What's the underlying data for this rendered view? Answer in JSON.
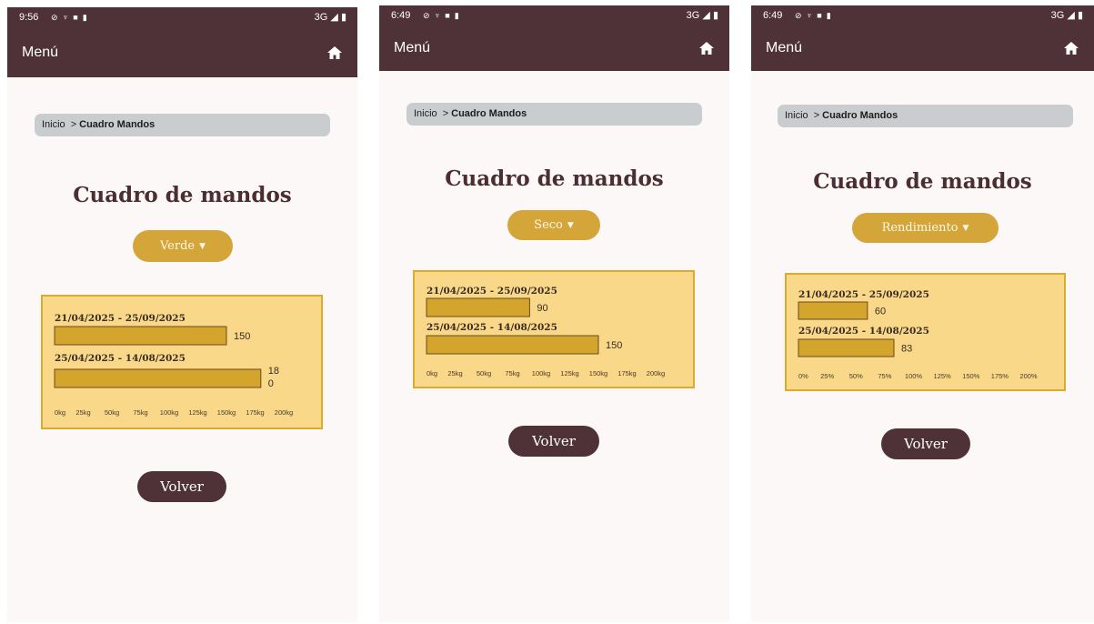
{
  "colors": {
    "appbar": "#4f3237",
    "accent": "#d4a63a",
    "chart_bg": "#f9d889",
    "bar": "#d4a52c",
    "title": "#4a2e33"
  },
  "screens": [
    {
      "status": {
        "time": "9:56",
        "icons": [
          "do-not-disturb-icon",
          "usb-icon",
          "notification-icon",
          "sd-card-icon"
        ],
        "network": "3G"
      },
      "appbar": {
        "menu": "Menú",
        "home_icon": "home-icon"
      },
      "breadcrumb": {
        "home": "Inicio",
        "separator": ">",
        "current": "Cuadro Mandos"
      },
      "title": "Cuadro de mandos",
      "dropdown": {
        "selected": "Verde"
      },
      "back": "Volver"
    },
    {
      "status": {
        "time": "6:49",
        "icons": [
          "do-not-disturb-icon",
          "usb-icon",
          "notification-icon",
          "sd-card-icon"
        ],
        "network": "3G"
      },
      "appbar": {
        "menu": "Menú",
        "home_icon": "home-icon"
      },
      "breadcrumb": {
        "home": "Inicio",
        "separator": ">",
        "current": "Cuadro Mandos"
      },
      "title": "Cuadro de mandos",
      "dropdown": {
        "selected": "Seco"
      },
      "back": "Volver"
    },
    {
      "status": {
        "time": "6:49",
        "icons": [
          "do-not-disturb-icon",
          "usb-icon",
          "notification-icon",
          "sd-card-icon"
        ],
        "network": "3G"
      },
      "appbar": {
        "menu": "Menú",
        "home_icon": "home-icon"
      },
      "breadcrumb": {
        "home": "Inicio",
        "separator": ">",
        "current": "Cuadro Mandos"
      },
      "title": "Cuadro de mandos",
      "dropdown": {
        "selected": "Rendimiento"
      },
      "back": "Volver"
    }
  ],
  "chart_data": [
    {
      "type": "bar",
      "orientation": "horizontal",
      "categories": [
        "21/04/2025 - 25/09/2025",
        "25/04/2025 - 14/08/2025"
      ],
      "values": [
        150,
        180
      ],
      "value_labels": [
        [
          "150"
        ],
        [
          "18",
          "0"
        ]
      ],
      "xlim": [
        0,
        200
      ],
      "ticks": [
        "0kg",
        "25kg",
        "50kg",
        "75kg",
        "100kg",
        "125kg",
        "150kg",
        "175kg",
        "200kg"
      ]
    },
    {
      "type": "bar",
      "orientation": "horizontal",
      "categories": [
        "21/04/2025 - 25/09/2025",
        "25/04/2025 - 14/08/2025"
      ],
      "values": [
        90,
        150
      ],
      "value_labels": [
        [
          "90"
        ],
        [
          "150"
        ]
      ],
      "xlim": [
        0,
        200
      ],
      "ticks": [
        "0kg",
        "25kg",
        "50kg",
        "75kg",
        "100kg",
        "125kg",
        "150kg",
        "175kg",
        "200kg"
      ]
    },
    {
      "type": "bar",
      "orientation": "horizontal",
      "categories": [
        "21/04/2025 - 25/09/2025",
        "25/04/2025 - 14/08/2025"
      ],
      "values": [
        60,
        83
      ],
      "value_labels": [
        [
          "60"
        ],
        [
          "83"
        ]
      ],
      "xlim": [
        0,
        200
      ],
      "ticks": [
        "0%",
        "25%",
        "50%",
        "75%",
        "100%",
        "125%",
        "150%",
        "175%",
        "200%"
      ]
    }
  ]
}
